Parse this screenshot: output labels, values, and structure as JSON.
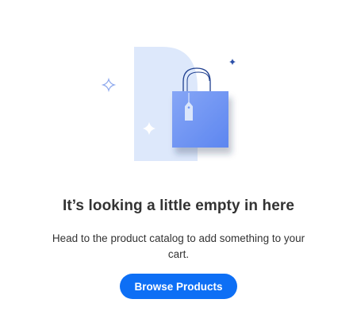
{
  "empty_state": {
    "heading": "It’s looking a little empty in here",
    "message": "Head to the product catalog to add something to your cart.",
    "browse_button_label": "Browse Products"
  },
  "illustration": {
    "icon": "shopping-bag-icon",
    "sparkles": [
      "sparkle-icon",
      "sparkle-icon",
      "sparkle-icon"
    ],
    "colors": {
      "backdrop": "#dde8fb",
      "bag": "#6f95f4",
      "bag_handle": "#1f3f8f",
      "tag": "#dbe6fb",
      "sparkle_small": "#2b4fa8",
      "sparkle_outline": "#8ea9ee",
      "sparkle_white": "#ffffff"
    }
  },
  "colors": {
    "accent": "#0d6ff5",
    "text": "#333333"
  }
}
